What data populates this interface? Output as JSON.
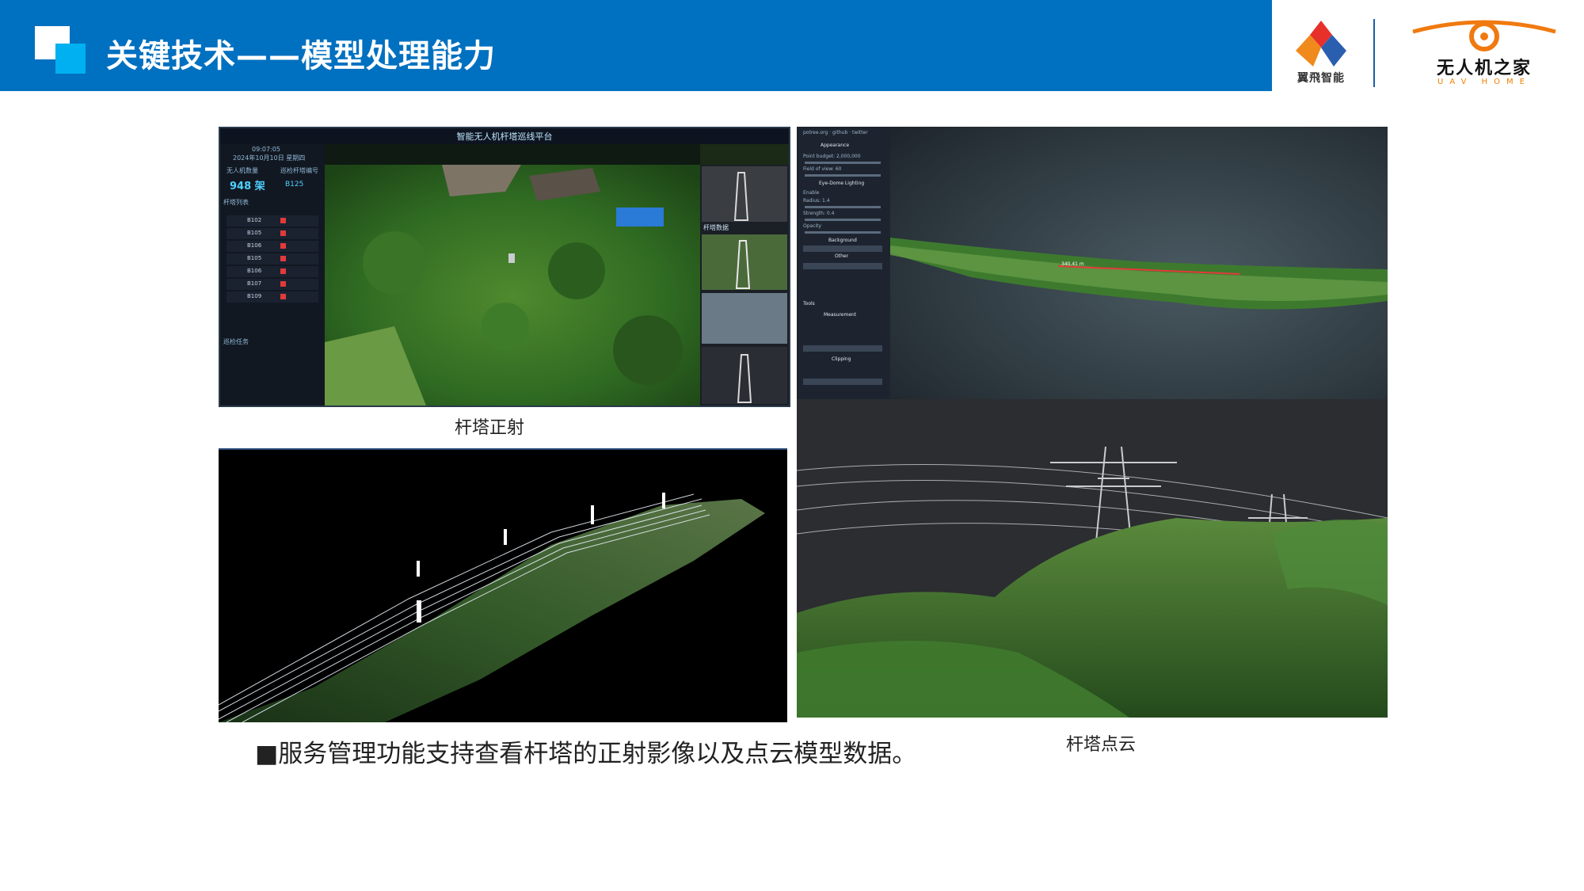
{
  "header": {
    "title": "关键技术——模型处理能力",
    "color": "#0070c0"
  },
  "logos": {
    "logo1_text": "翼飛智能",
    "logo2_name": "无人机之家",
    "logo2_sub": "UAV HOME"
  },
  "platform_screenshot": {
    "title": "智能无人机杆塔巡线平台",
    "time": "09:07:05",
    "date": "2024年10月10日 星期四",
    "stat_label_1": "无人机数量",
    "stat_label_2": "巡检杆塔编号",
    "count": "948 架",
    "tower_id": "B125",
    "list_label": "杆塔列表",
    "rows": [
      "B102",
      "B105",
      "B106",
      "B105",
      "B106",
      "B107",
      "B109"
    ],
    "task_label": "巡检任务",
    "thumbs_label": "杆塔数据"
  },
  "pointcloud_viewer": {
    "header": "potree.org · github · twitter",
    "section_1": "Appearance",
    "point_budget": "Point budget: 2,000,000",
    "fov": "Field of view: 60",
    "section_2": "Eye-Dome Lighting",
    "enable": "Enable",
    "radius": "Radius: 1.4",
    "strength": "Strength: 0.4",
    "opacity": "Opacity",
    "section_3": "Background",
    "section_4": "Other",
    "section_5": "Tools",
    "section_6": "Measurement",
    "section_7": "Clipping",
    "distance_label": "340.41 m"
  },
  "captions": {
    "orthophoto": "杆塔正射",
    "pointcloud": "杆塔点云"
  },
  "bullet_text": "■服务管理功能支持查看杆塔的正射影像以及点云模型数据。"
}
